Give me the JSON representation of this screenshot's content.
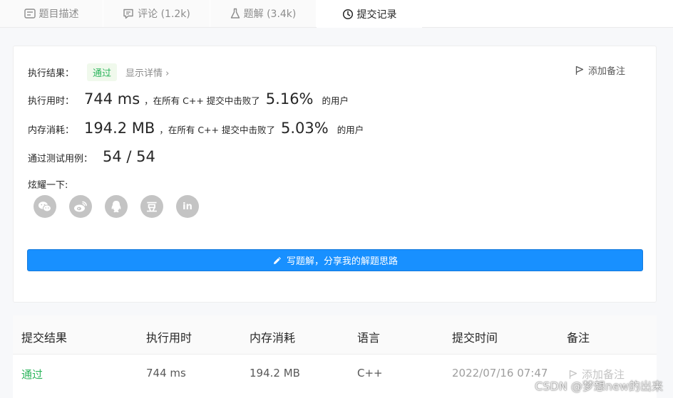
{
  "tabs": [
    {
      "label": "题目描述",
      "icon": "description-icon"
    },
    {
      "label": "评论 (1.2k)",
      "icon": "comment-icon"
    },
    {
      "label": "题解 (3.4k)",
      "icon": "flask-icon"
    },
    {
      "label": "提交记录",
      "icon": "clock-icon",
      "active": true
    }
  ],
  "result": {
    "label": "执行结果：",
    "status": "通过",
    "details_link": "显示详情 ›",
    "add_note": "添加备注"
  },
  "runtime": {
    "label": "执行用时：",
    "value": "744 ms",
    "mid": "，在所有 C++ 提交中击败了",
    "percent": "5.16%",
    "suffix": "的用户"
  },
  "memory": {
    "label": "内存消耗：",
    "value": "194.2 MB",
    "mid": "，在所有 C++ 提交中击败了",
    "percent": "5.03%",
    "suffix": "的用户"
  },
  "tests": {
    "label": "通过测试用例：",
    "value": "54 / 54"
  },
  "share": {
    "label": "炫耀一下:",
    "icons": [
      "wechat-icon",
      "weibo-icon",
      "qq-icon",
      "douban-icon",
      "linkedin-icon"
    ],
    "douban_glyph": "豆",
    "linkedin_glyph": "in"
  },
  "write_button": "写题解，分享我的解题思路",
  "table": {
    "headers": [
      "提交结果",
      "执行用时",
      "内存消耗",
      "语言",
      "提交时间",
      "备注"
    ],
    "rows": [
      {
        "result": "通过",
        "runtime": "744 ms",
        "memory": "194.2 MB",
        "language": "C++",
        "time": "2022/07/16 07:47",
        "note": "添加备注"
      }
    ]
  },
  "watermark": "CSDN @梦想new的出来",
  "colors": {
    "accent": "#1890ff",
    "success": "#2db55d",
    "share_gray": "#c4c4c4"
  }
}
